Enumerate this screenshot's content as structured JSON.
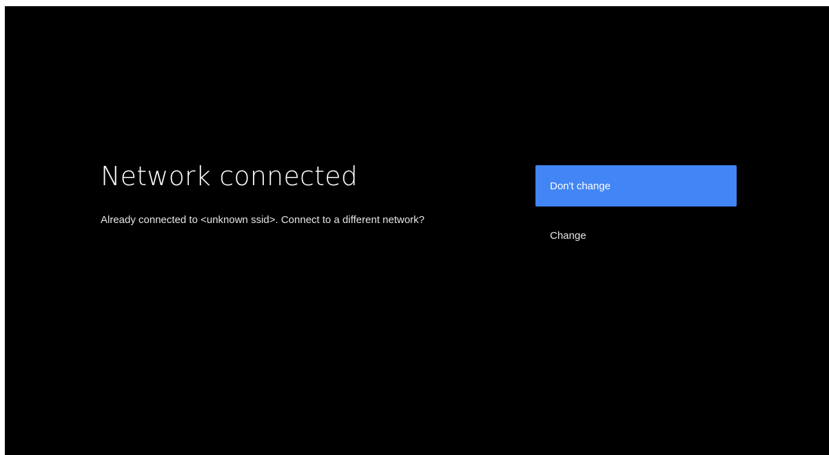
{
  "colors": {
    "background": "#000000",
    "accent": "#4285F4",
    "text_primary": "#FFFFFF",
    "text_secondary": "#E6E6E6"
  },
  "guidance": {
    "title": "Network connected",
    "description": "Already connected to <unknown ssid>. Connect to a different network?"
  },
  "actions": [
    {
      "label": "Don't change",
      "focused": true
    },
    {
      "label": "Change",
      "focused": false
    }
  ]
}
